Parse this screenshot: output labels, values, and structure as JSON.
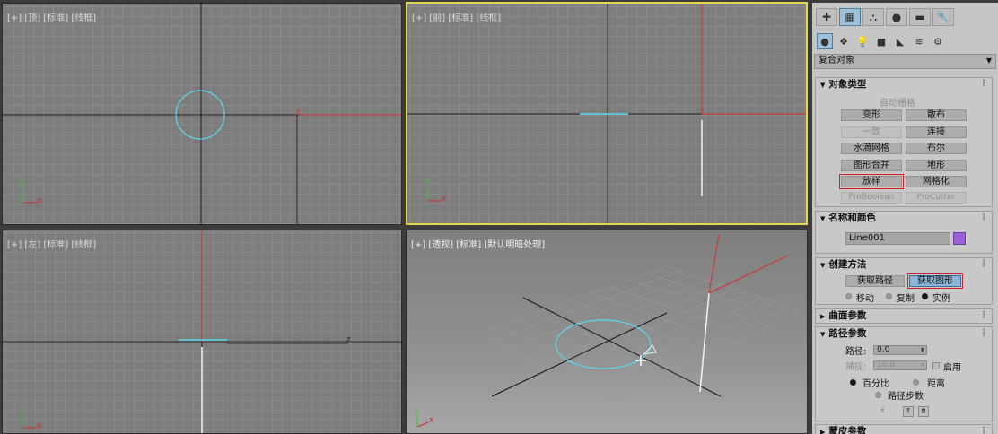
{
  "viewports": {
    "top": {
      "label": "[+] [顶] [标准] [线框]"
    },
    "front": {
      "label": "[+] [前] [标准] [线框]"
    },
    "left": {
      "label": "[+] [左] [标准] [线框]"
    },
    "perspective": {
      "label": "[+] [透视] [标准] [默认明暗处理]"
    }
  },
  "axes": {
    "x": "x",
    "y": "y",
    "z": "z"
  },
  "panel": {
    "tabs": [
      {
        "icon": "plus-icon",
        "glyph": "✚"
      },
      {
        "icon": "modify-icon",
        "glyph": "▦"
      },
      {
        "icon": "hierarchy-icon",
        "glyph": "⛬"
      },
      {
        "icon": "motion-icon",
        "glyph": "●"
      },
      {
        "icon": "display-icon",
        "glyph": "▬"
      },
      {
        "icon": "utilities-icon",
        "glyph": "🔧"
      }
    ],
    "subtabs": [
      {
        "icon": "geometry-icon",
        "glyph": "●"
      },
      {
        "icon": "shapes-icon",
        "glyph": "❖"
      },
      {
        "icon": "lights-icon",
        "glyph": "💡"
      },
      {
        "icon": "cameras-icon",
        "glyph": "■"
      },
      {
        "icon": "helpers-icon",
        "glyph": "◣"
      },
      {
        "icon": "spacewarps-icon",
        "glyph": "≋"
      },
      {
        "icon": "systems-icon",
        "glyph": "⚙"
      }
    ],
    "category": "复合对象",
    "object_type": {
      "title": "对象类型",
      "autogrid": "自动栅格",
      "buttons": [
        "变形",
        "散布",
        "一致",
        "连接",
        "水滴网格",
        "布尔",
        "图形合并",
        "地形",
        "放样",
        "网格化",
        "ProBoolean",
        "ProCutter"
      ]
    },
    "name_color": {
      "title": "名称和颜色",
      "name": "Line001",
      "color": "#9c5fdc"
    },
    "creation_method": {
      "title": "创建方法",
      "get_path": "获取路径",
      "get_shape": "获取图形",
      "move": "移动",
      "copy": "复制",
      "instance": "实例"
    },
    "surface_params": {
      "title": "曲面参数"
    },
    "path_params": {
      "title": "路径参数",
      "path_label": "路径:",
      "path_value": "0.0",
      "snap_label": "捕捉:",
      "snap_value": "10.0",
      "enable": "启用",
      "percent": "百分比",
      "distance": "距离",
      "path_steps": "路径步数"
    },
    "skin_params": {
      "title": "蒙皮参数"
    }
  }
}
